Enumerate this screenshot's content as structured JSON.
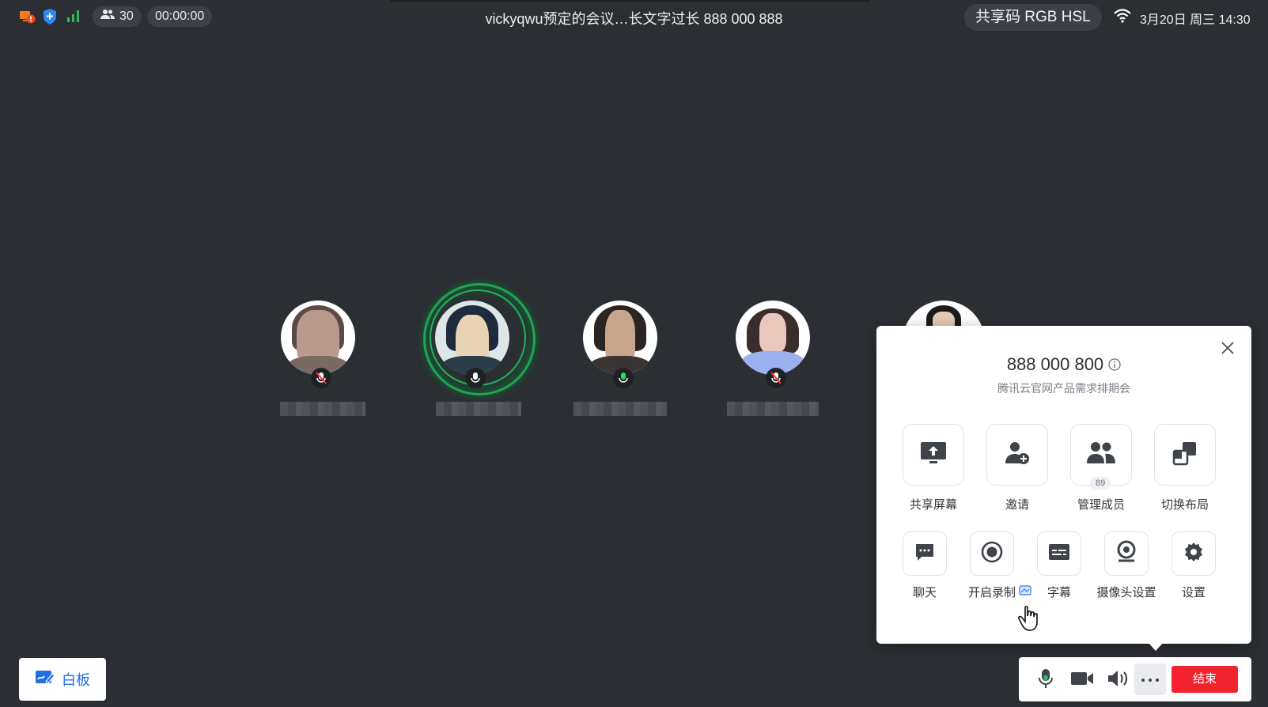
{
  "topbar": {
    "participant_count": "30",
    "timer": "00:00:00",
    "meeting_title": "vickyqwu预定的会议…长文字过长  888 000 888",
    "share_code": "共享码 RGB HSL",
    "datetime": "3月20日 周三 14:30"
  },
  "panel": {
    "meeting_id": "888 000 800",
    "meeting_name": "腾讯云官网产品需求排期会",
    "row1": [
      {
        "label": "共享屏幕",
        "icon": "share-screen-icon"
      },
      {
        "label": "邀请",
        "icon": "invite-user-icon"
      },
      {
        "label": "管理成员",
        "icon": "members-icon",
        "badge": "89"
      },
      {
        "label": "切换布局",
        "icon": "layout-icon"
      }
    ],
    "row2": [
      {
        "label": "聊天",
        "icon": "chat-icon"
      },
      {
        "label": "开启录制",
        "icon": "record-icon"
      },
      {
        "label": "字幕",
        "icon": "subtitle-icon"
      },
      {
        "label": "摄像头设置",
        "icon": "camera-settings-icon"
      },
      {
        "label": "设置",
        "icon": "gear-icon"
      }
    ]
  },
  "whiteboard": {
    "label": "白板"
  },
  "controls": {
    "end_label": "结束"
  },
  "colors": {
    "accent_blue": "#1f6fe5",
    "end_red": "#f2232e",
    "speaking_green": "#1ea453",
    "background": "#2b2e33"
  }
}
